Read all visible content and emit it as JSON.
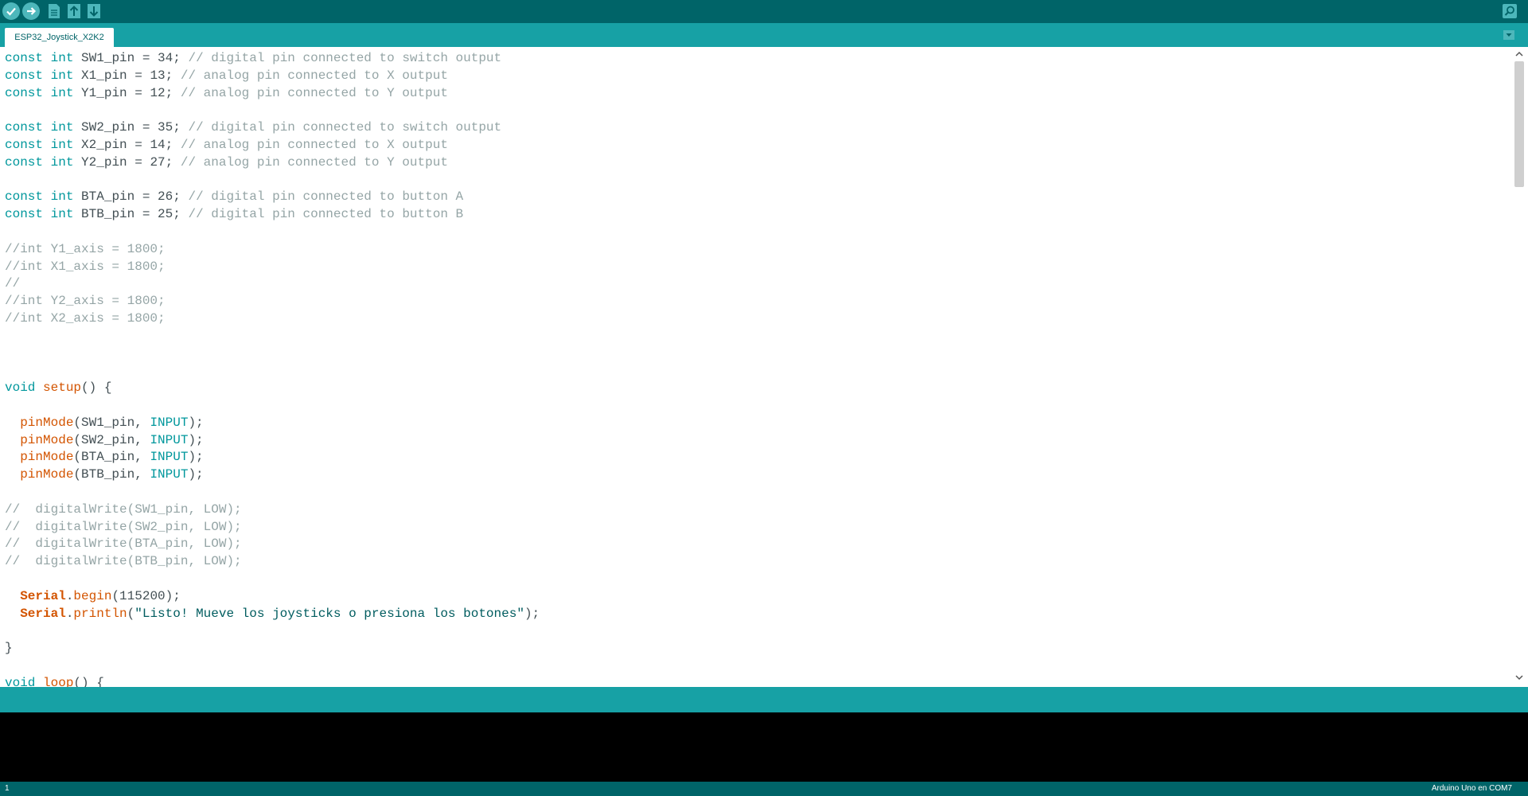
{
  "toolbar": {
    "buttons": [
      {
        "name": "verify",
        "icon": "check-icon"
      },
      {
        "name": "upload",
        "icon": "arrow-right-icon"
      },
      {
        "name": "new",
        "icon": "file-icon"
      },
      {
        "name": "open",
        "icon": "arrow-up-icon"
      },
      {
        "name": "save",
        "icon": "arrow-down-icon"
      },
      {
        "name": "serial-monitor",
        "icon": "magnifier-icon"
      }
    ]
  },
  "tab": {
    "label": "ESP32_Joystick_X2K2"
  },
  "code": [
    [
      [
        "kw",
        "const"
      ],
      [
        "p",
        " "
      ],
      [
        "kw",
        "int"
      ],
      [
        "p",
        " SW1_pin = 34; "
      ],
      [
        "c",
        "// digital pin connected to switch output"
      ]
    ],
    [
      [
        "kw",
        "const"
      ],
      [
        "p",
        " "
      ],
      [
        "kw",
        "int"
      ],
      [
        "p",
        " X1_pin = 13; "
      ],
      [
        "c",
        "// analog pin connected to X output"
      ]
    ],
    [
      [
        "kw",
        "const"
      ],
      [
        "p",
        " "
      ],
      [
        "kw",
        "int"
      ],
      [
        "p",
        " Y1_pin = 12; "
      ],
      [
        "c",
        "// analog pin connected to Y output"
      ]
    ],
    [],
    [
      [
        "kw",
        "const"
      ],
      [
        "p",
        " "
      ],
      [
        "kw",
        "int"
      ],
      [
        "p",
        " SW2_pin = 35; "
      ],
      [
        "c",
        "// digital pin connected to switch output"
      ]
    ],
    [
      [
        "kw",
        "const"
      ],
      [
        "p",
        " "
      ],
      [
        "kw",
        "int"
      ],
      [
        "p",
        " X2_pin = 14; "
      ],
      [
        "c",
        "// analog pin connected to X output"
      ]
    ],
    [
      [
        "kw",
        "const"
      ],
      [
        "p",
        " "
      ],
      [
        "kw",
        "int"
      ],
      [
        "p",
        " Y2_pin = 27; "
      ],
      [
        "c",
        "// analog pin connected to Y output"
      ]
    ],
    [],
    [
      [
        "kw",
        "const"
      ],
      [
        "p",
        " "
      ],
      [
        "kw",
        "int"
      ],
      [
        "p",
        " BTA_pin = 26; "
      ],
      [
        "c",
        "// digital pin connected to button A"
      ]
    ],
    [
      [
        "kw",
        "const"
      ],
      [
        "p",
        " "
      ],
      [
        "kw",
        "int"
      ],
      [
        "p",
        " BTB_pin = 25; "
      ],
      [
        "c",
        "// digital pin connected to button B"
      ]
    ],
    [],
    [
      [
        "c",
        "//int Y1_axis = 1800;"
      ]
    ],
    [
      [
        "c",
        "//int X1_axis = 1800;"
      ]
    ],
    [
      [
        "c",
        "//"
      ]
    ],
    [
      [
        "c",
        "//int Y2_axis = 1800;"
      ]
    ],
    [
      [
        "c",
        "//int X2_axis = 1800;"
      ]
    ],
    [],
    [],
    [],
    [
      [
        "kw",
        "void"
      ],
      [
        "p",
        " "
      ],
      [
        "fn",
        "setup"
      ],
      [
        "p",
        "() {"
      ]
    ],
    [],
    [
      [
        "p",
        "  "
      ],
      [
        "fn",
        "pinMode"
      ],
      [
        "p",
        "(SW1_pin, "
      ],
      [
        "cst",
        "INPUT"
      ],
      [
        "p",
        ");"
      ]
    ],
    [
      [
        "p",
        "  "
      ],
      [
        "fn",
        "pinMode"
      ],
      [
        "p",
        "(SW2_pin, "
      ],
      [
        "cst",
        "INPUT"
      ],
      [
        "p",
        ");"
      ]
    ],
    [
      [
        "p",
        "  "
      ],
      [
        "fn",
        "pinMode"
      ],
      [
        "p",
        "(BTA_pin, "
      ],
      [
        "cst",
        "INPUT"
      ],
      [
        "p",
        ");"
      ]
    ],
    [
      [
        "p",
        "  "
      ],
      [
        "fn",
        "pinMode"
      ],
      [
        "p",
        "(BTB_pin, "
      ],
      [
        "cst",
        "INPUT"
      ],
      [
        "p",
        ");"
      ]
    ],
    [],
    [
      [
        "c",
        "//  digitalWrite(SW1_pin, LOW);"
      ]
    ],
    [
      [
        "c",
        "//  digitalWrite(SW2_pin, LOW);"
      ]
    ],
    [
      [
        "c",
        "//  digitalWrite(BTA_pin, LOW);"
      ]
    ],
    [
      [
        "c",
        "//  digitalWrite(BTB_pin, LOW);"
      ]
    ],
    [],
    [
      [
        "p",
        "  "
      ],
      [
        "cls",
        "Serial"
      ],
      [
        "p",
        "."
      ],
      [
        "fn",
        "begin"
      ],
      [
        "p",
        "(115200);"
      ]
    ],
    [
      [
        "p",
        "  "
      ],
      [
        "cls",
        "Serial"
      ],
      [
        "p",
        "."
      ],
      [
        "fn",
        "println"
      ],
      [
        "p",
        "("
      ],
      [
        "str",
        "\"Listo! Mueve los joysticks o presiona los botones\""
      ],
      [
        "p",
        ");"
      ]
    ],
    [],
    [
      [
        "p",
        "}"
      ]
    ],
    [],
    [
      [
        "kw",
        "void"
      ],
      [
        "p",
        " "
      ],
      [
        "fn",
        "loop"
      ],
      [
        "p",
        "() {"
      ]
    ]
  ],
  "status": {
    "line_number": "1",
    "board": "Arduino Uno en COM7"
  },
  "colors": {
    "toolbar": "#006468",
    "accent": "#17a1a5",
    "keyword": "#00979c",
    "function": "#d35400",
    "comment": "#95a5a6"
  }
}
